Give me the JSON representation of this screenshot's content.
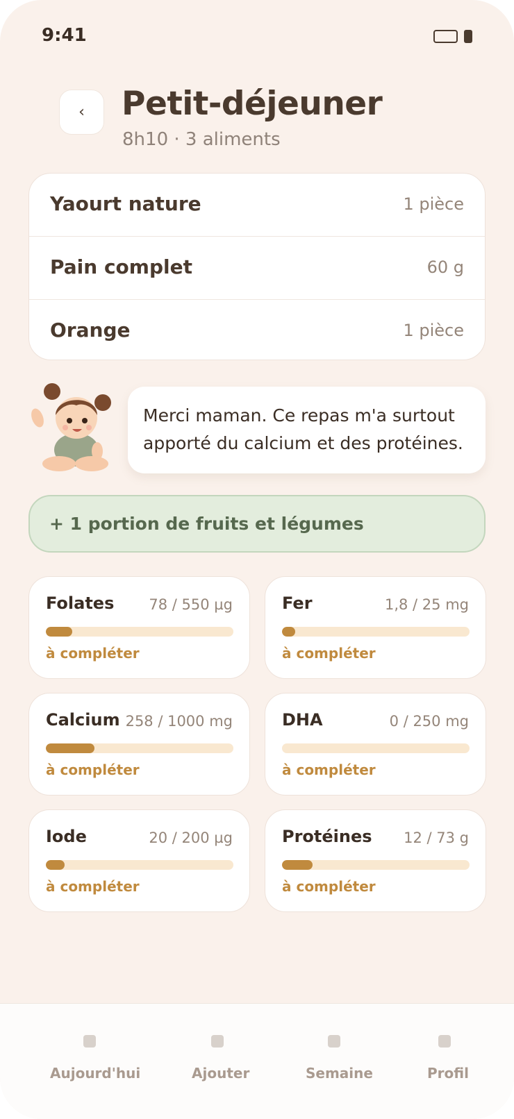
{
  "status_bar": {
    "time": "9:41"
  },
  "header": {
    "back_label": "‹",
    "title": "Petit-déjeuner",
    "subtitle": "8h10 · 3 aliments"
  },
  "foods": [
    {
      "name": "Yaourt nature",
      "qty": "1 pièce"
    },
    {
      "name": "Pain complet",
      "qty": "60 g"
    },
    {
      "name": "Orange",
      "qty": "1 pièce"
    }
  ],
  "message": "Merci maman. Ce repas m'a surtout apporté du calcium et des protéines.",
  "fruit_banner": "+ 1 portion de fruits et légumes",
  "nutrients": [
    {
      "name": "Folates",
      "value": "78 / 550 µg",
      "progress": 0.142,
      "status": "à compléter"
    },
    {
      "name": "Fer",
      "value": "1,8 / 25 mg",
      "progress": 0.072,
      "status": "à compléter"
    },
    {
      "name": "Calcium",
      "value": "258 / 1000 mg",
      "progress": 0.258,
      "status": "à compléter"
    },
    {
      "name": "DHA",
      "value": "0 / 250 mg",
      "progress": 0.0,
      "status": "à compléter"
    },
    {
      "name": "Iode",
      "value": "20 / 200 µg",
      "progress": 0.1,
      "status": "à compléter"
    },
    {
      "name": "Protéines",
      "value": "12 / 73 g",
      "progress": 0.164,
      "status": "à compléter"
    }
  ],
  "nav": [
    {
      "label": "Aujourd'hui"
    },
    {
      "label": "Ajouter"
    },
    {
      "label": "Semaine"
    },
    {
      "label": "Profil"
    }
  ],
  "colors": {
    "background": "#faf1eb",
    "accent": "#c08a3e",
    "track": "#f9e8d0",
    "banner_bg": "#e3eddd",
    "banner_text": "#56684e"
  }
}
